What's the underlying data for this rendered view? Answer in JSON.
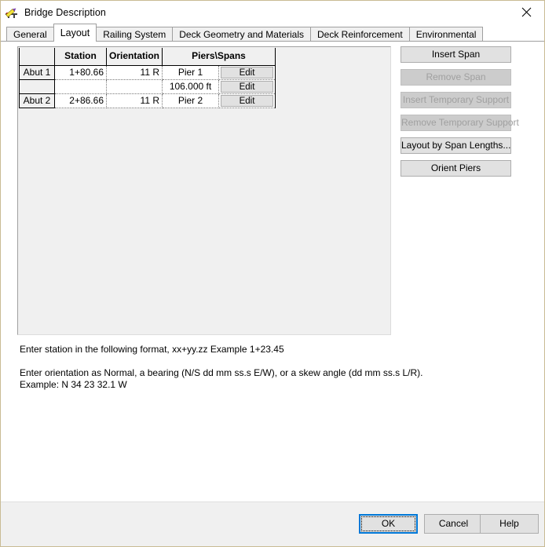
{
  "window": {
    "title": "Bridge Description",
    "icon": "bridge-pencil-icon",
    "close_label": "✕",
    "border_color": "#c9bb94"
  },
  "tabs": [
    {
      "label": "General",
      "selected": false
    },
    {
      "label": "Layout",
      "selected": true
    },
    {
      "label": "Railing System",
      "selected": false
    },
    {
      "label": "Deck Geometry and Materials",
      "selected": false
    },
    {
      "label": "Deck Reinforcement",
      "selected": false
    },
    {
      "label": "Environmental",
      "selected": false
    }
  ],
  "grid": {
    "headers": [
      "",
      "Station",
      "Orientation",
      "Piers\\Spans"
    ],
    "rows": [
      {
        "rowhead": "Abut 1",
        "station": "1+80.66",
        "orientation": "11 R",
        "pier": "Pier 1",
        "edit_label": "Edit"
      },
      {
        "rowhead": "",
        "station": "",
        "orientation": "",
        "pier": "106.000 ft",
        "edit_label": "Edit"
      },
      {
        "rowhead": "Abut 2",
        "station": "2+86.66",
        "orientation": "11 R",
        "pier": "Pier 2",
        "edit_label": "Edit"
      }
    ]
  },
  "side_buttons": [
    {
      "label": "Insert Span",
      "disabled": false
    },
    {
      "label": "Remove Span",
      "disabled": true
    },
    {
      "label": "Insert Temporary Support",
      "disabled": true
    },
    {
      "label": "Remove Temporary Support",
      "disabled": true
    },
    {
      "label": "Layout by Span Lengths...",
      "disabled": false
    },
    {
      "label": "Orient Piers",
      "disabled": false
    }
  ],
  "hints": {
    "line1": "Enter station in the following format, xx+yy.zz  Example 1+23.45",
    "line2": "Enter orientation as Normal, a bearing (N/S dd mm ss.s E/W), or a skew angle (dd mm ss.s L/R).",
    "line3": "Example: N 34 23 32.1 W"
  },
  "footer": {
    "ok_label": "OK",
    "cancel_label": "Cancel",
    "help_label": "Help",
    "focus_color": "#0078d7"
  }
}
